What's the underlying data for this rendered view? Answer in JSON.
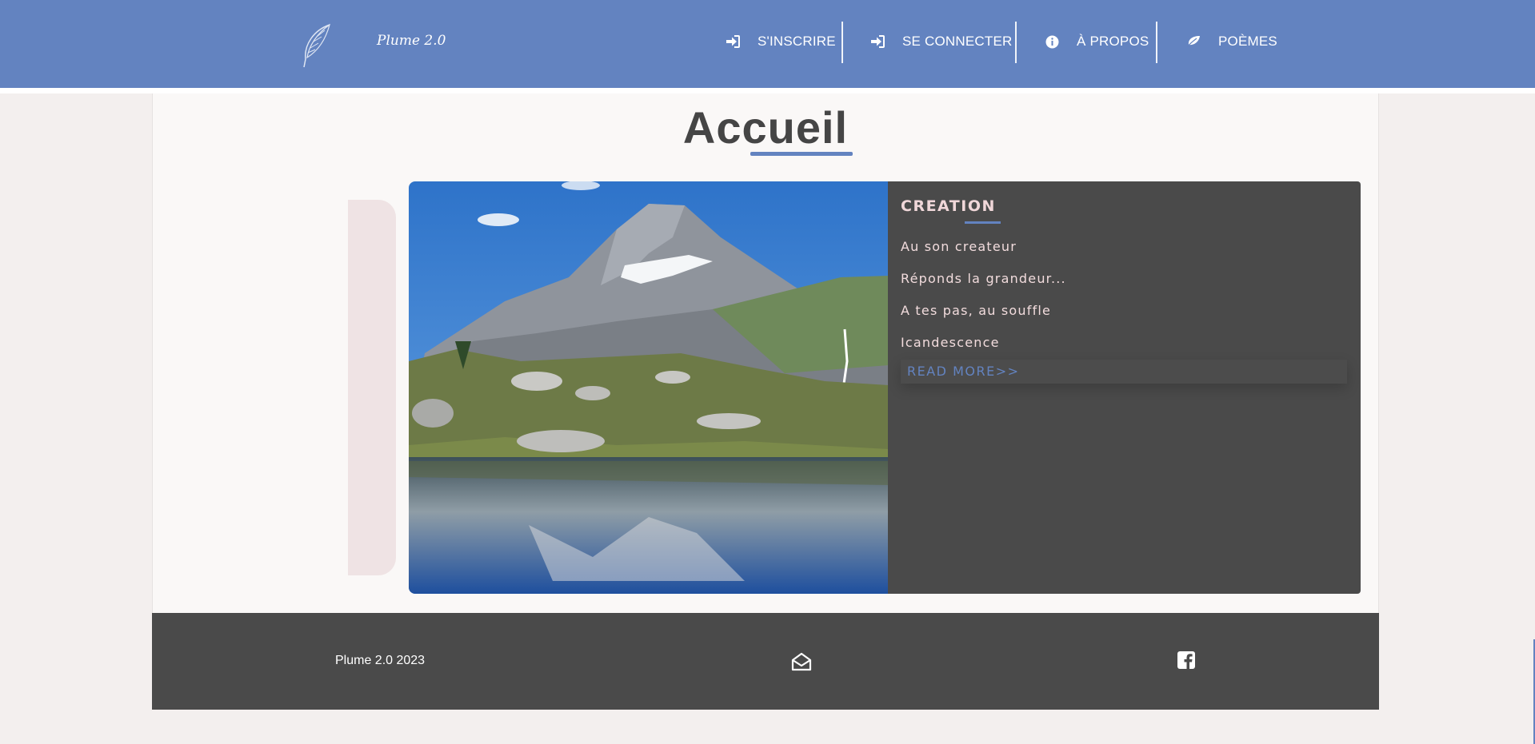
{
  "header": {
    "brand": "Plume 2.0",
    "logo_icon": "feather-icon",
    "nav": [
      {
        "label": "S'INSCRIRE",
        "icon": "sign-in-icon"
      },
      {
        "label": "SE CONNECTER",
        "icon": "sign-in-icon"
      },
      {
        "label": "À PROPOS",
        "icon": "info-circle-icon"
      },
      {
        "label": "POÈMES",
        "icon": "leaf-icon"
      }
    ]
  },
  "main": {
    "title": "Accueil",
    "card": {
      "title": "CREATION",
      "poems": [
        "Au son createur",
        "Réponds la grandeur...",
        "A tes pas, au souffle",
        "Icandescence"
      ],
      "read_more": "READ MORE>>"
    }
  },
  "footer": {
    "text": "Plume 2.0 2023",
    "icons": [
      "envelope-open-icon",
      "facebook-icon"
    ]
  },
  "colors": {
    "accent": "#6383c0",
    "dark": "#4a4a4a",
    "background": "#f3efee",
    "pink_text": "#f2dcdd"
  }
}
